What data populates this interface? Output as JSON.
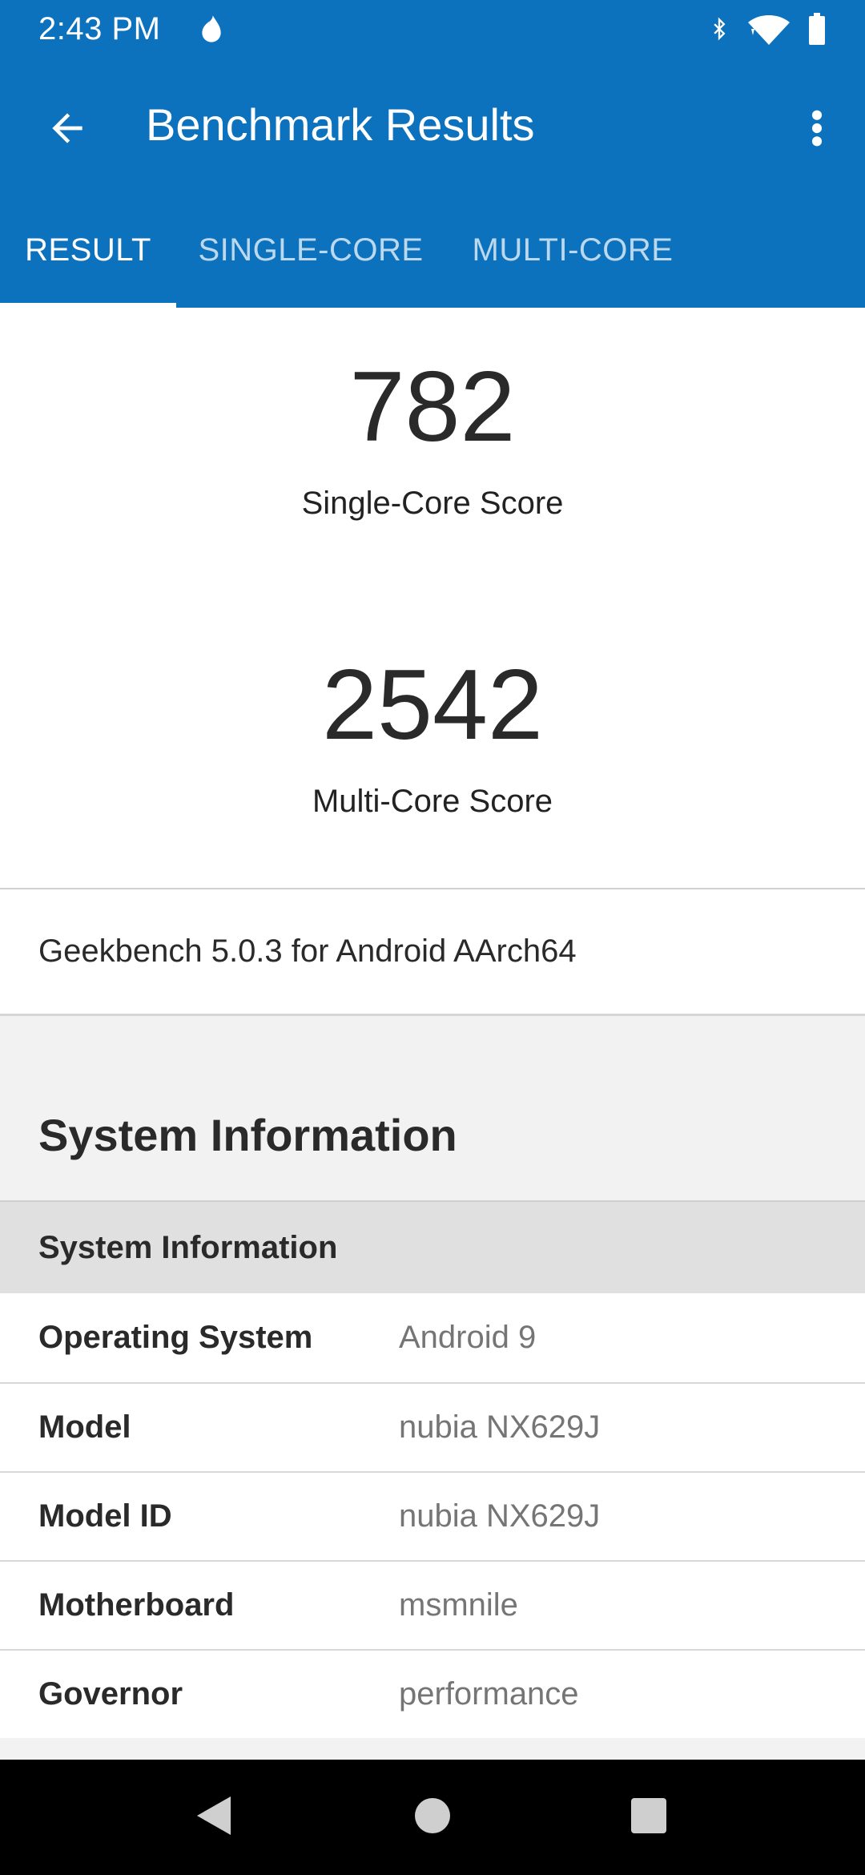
{
  "status_bar": {
    "time": "2:43 PM",
    "icons": [
      "fire-icon",
      "bluetooth-icon",
      "wifi-icon",
      "battery-icon"
    ]
  },
  "app_bar": {
    "title": "Benchmark Results",
    "back_icon": "arrow-back-icon",
    "more_icon": "more-vert-icon"
  },
  "tabs": [
    {
      "label": "RESULT",
      "active": true
    },
    {
      "label": "SINGLE-CORE",
      "active": false
    },
    {
      "label": "MULTI-CORE",
      "active": false
    }
  ],
  "scores": {
    "single": {
      "value": "782",
      "label": "Single-Core Score"
    },
    "multi": {
      "value": "2542",
      "label": "Multi-Core Score"
    }
  },
  "version": "Geekbench 5.0.3 for Android AArch64",
  "system_information": {
    "title": "System Information",
    "table_header": "System Information",
    "rows": [
      {
        "key": "Operating System",
        "value": "Android 9"
      },
      {
        "key": "Model",
        "value": "nubia NX629J"
      },
      {
        "key": "Model ID",
        "value": "nubia NX629J"
      },
      {
        "key": "Motherboard",
        "value": "msmnile"
      },
      {
        "key": "Governor",
        "value": "performance"
      }
    ]
  },
  "colors": {
    "primary": "#0c72bd",
    "background": "#f2f2f2"
  },
  "nav_bar": {
    "icons": [
      "nav-back-icon",
      "nav-home-icon",
      "nav-recents-icon"
    ]
  }
}
